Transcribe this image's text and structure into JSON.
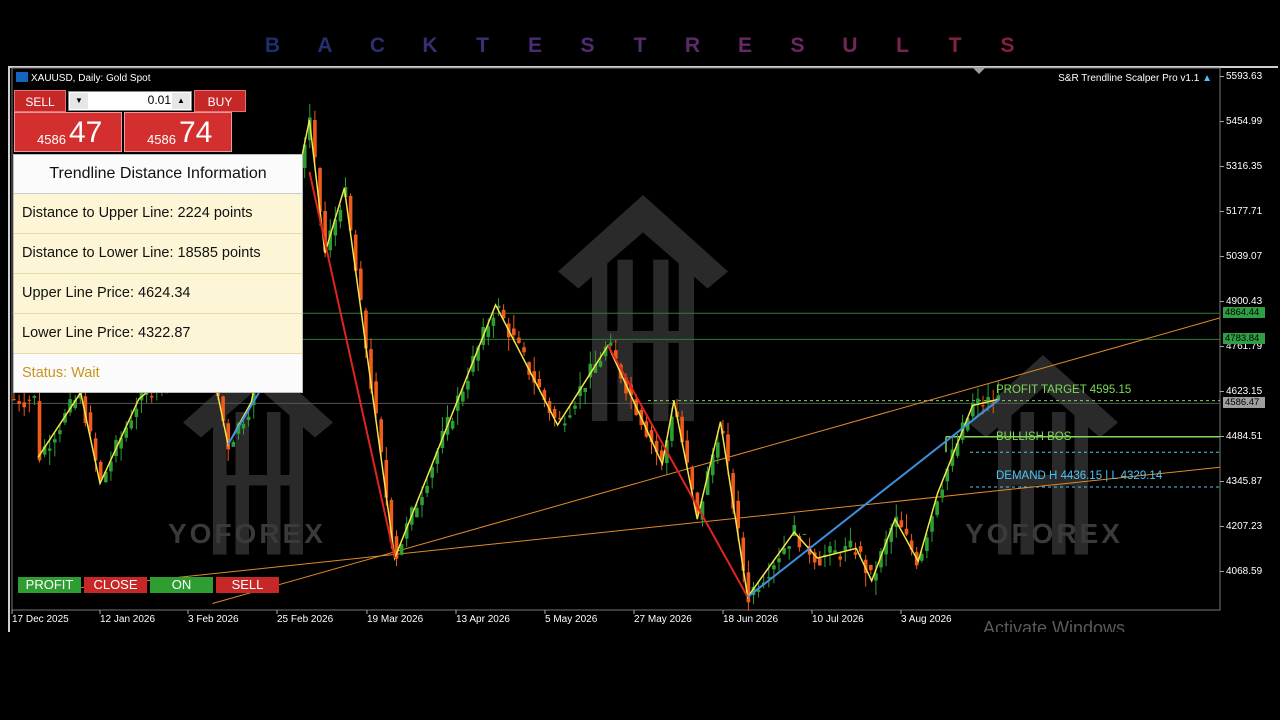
{
  "banner": {
    "letters": [
      "B",
      "A",
      "C",
      "K",
      "T",
      "E",
      "S",
      "T",
      "R",
      "E",
      "S",
      "U",
      "L",
      "T",
      "S"
    ],
    "colors": [
      "#1f2e70",
      "#24306e",
      "#2c2f6e",
      "#353072",
      "#3f2f74",
      "#482d74",
      "#502c72",
      "#572b6e",
      "#5e2a6a",
      "#652964",
      "#6c285e",
      "#742657",
      "#7b244f",
      "#822246",
      "#8a1f3d"
    ]
  },
  "chart_header": {
    "symbol": "XAUUSD, Daily:  Gold Spot",
    "indicator_name": "S&R Trendline Scalper Pro v1.1"
  },
  "one_click": {
    "sell_label": "SELL",
    "buy_label": "BUY",
    "lot": "0.01",
    "sell_price_small": "4586",
    "sell_price_big": "47",
    "buy_price_small": "4586",
    "buy_price_big": "74"
  },
  "info_panel": {
    "title": "Trendline Distance Information",
    "rows": [
      "Distance to Upper Line: 2224 points",
      "Distance to Lower Line: 18585 points",
      "Upper Line Price: 4624.34",
      "Lower Line Price: 4322.87"
    ],
    "status": "Status: Wait"
  },
  "controls": {
    "profit": "PROFIT",
    "close": "CLOSE",
    "on": "ON",
    "sell": "SELL"
  },
  "watermark": {
    "text": "YOFOREX"
  },
  "annotations": {
    "profit_target": "PROFIT TARGET 4595.15",
    "bullish_bos": "BULLISH BOS",
    "demand": "DEMAND H 4436.15 | L 4329.14"
  },
  "os_notice": "Activate Windows",
  "chart_data": {
    "type": "candlestick",
    "symbol": "XAUUSD",
    "timeframe": "Daily",
    "y_ticks": [
      5593.63,
      5454.99,
      5316.35,
      5177.71,
      5039.07,
      4900.43,
      4761.79,
      4623.15,
      4484.51,
      4345.87,
      4207.23,
      4068.59
    ],
    "y_tick_labels": [
      "5593.63",
      "5454.99",
      "5316.35",
      "5177.71",
      "5039.07",
      "4900.43",
      "4761.79",
      "4623.15",
      "4484.51",
      "4345.87",
      "4207.23",
      "4068.59"
    ],
    "ylim": [
      3950,
      5620
    ],
    "x_tick_labels": [
      "17 Dec 2025",
      "12 Jan 2026",
      "3 Feb 2026",
      "25 Feb 2026",
      "19 Mar 2026",
      "13 Apr 2026",
      "5 May 2026",
      "27 May 2026",
      "18 Jun 2026",
      "10 Jul 2026",
      "3 Aug 2026"
    ],
    "price_tags": [
      {
        "label": "4864.44",
        "value": 4864.44,
        "color": "#2ea043"
      },
      {
        "label": "4783.84",
        "value": 4783.84,
        "color": "#2ea043"
      },
      {
        "label": "4586.47",
        "value": 4586.47,
        "color": "#9e9e9e"
      }
    ],
    "horizontal_levels": {
      "resistance_1": 4864.44,
      "resistance_2": 4783.84,
      "current": 4586.47,
      "profit_target": 4595.15,
      "bullish_bos": 4484.0,
      "demand_high": 4436.15,
      "demand_low": 4329.14
    },
    "zigzag": [
      [
        "2025-12-17",
        4420
      ],
      [
        "2025-12-28",
        4620
      ],
      [
        "2026-01-02",
        4340
      ],
      [
        "2026-01-12",
        4600
      ],
      [
        "2026-01-20",
        4680
      ],
      [
        "2026-01-30",
        4750
      ],
      [
        "2026-02-04",
        4460
      ],
      [
        "2026-02-10",
        4590
      ],
      [
        "2026-02-25",
        5460
      ],
      [
        "2026-03-01",
        5050
      ],
      [
        "2026-03-06",
        5250
      ],
      [
        "2026-03-19",
        4110
      ],
      [
        "2026-04-14",
        4890
      ],
      [
        "2026-04-30",
        4520
      ],
      [
        "2026-05-13",
        4765
      ],
      [
        "2026-05-27",
        4400
      ],
      [
        "2026-05-30",
        4595
      ],
      [
        "2026-06-05",
        4230
      ],
      [
        "2026-06-11",
        4530
      ],
      [
        "2026-06-18",
        3990
      ],
      [
        "2026-06-30",
        4190
      ],
      [
        "2026-07-06",
        4110
      ],
      [
        "2026-07-16",
        4140
      ],
      [
        "2026-07-20",
        4040
      ],
      [
        "2026-07-26",
        4230
      ],
      [
        "2026-08-01",
        4100
      ],
      [
        "2026-08-06",
        4310
      ],
      [
        "2026-08-15",
        4580
      ],
      [
        "2026-08-22",
        4600
      ]
    ],
    "red_segments": [
      [
        [
          "2026-02-25",
          5300
        ],
        [
          "2026-03-19",
          4110
        ]
      ],
      [
        [
          "2026-05-13",
          4765
        ],
        [
          "2026-06-18",
          3990
        ]
      ]
    ],
    "blue_segments": [
      [
        [
          "2026-02-04",
          4460
        ],
        [
          "2026-02-17",
          4720
        ]
      ],
      [
        [
          "2026-06-18",
          3990
        ],
        [
          "2026-08-22",
          4600
        ]
      ]
    ],
    "orange_trendlines": [
      [
        [
          "2026-01-31",
          3970
        ],
        [
          "2026-09-30",
          4850
        ]
      ],
      [
        [
          "2025-12-17",
          4005
        ],
        [
          "2026-09-30",
          4390
        ]
      ]
    ]
  }
}
